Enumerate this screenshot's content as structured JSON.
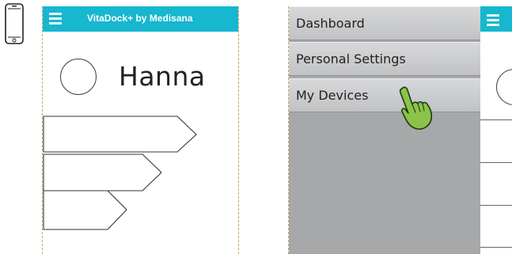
{
  "left_screen": {
    "app_title": "VitaDock+ by Medisana",
    "user_name": "Hanna"
  },
  "drawer": {
    "items": [
      {
        "label": "Dashboard"
      },
      {
        "label": "Personal Settings"
      },
      {
        "label": "My Devices"
      }
    ]
  },
  "colors": {
    "header": "#16b7cf",
    "drawer_bg": "#a7a8aa",
    "cursor": "#8bc34a"
  },
  "icons": {
    "device": "smartphone-icon",
    "menu": "hamburger-icon",
    "cursor": "hand-pointer-icon"
  }
}
